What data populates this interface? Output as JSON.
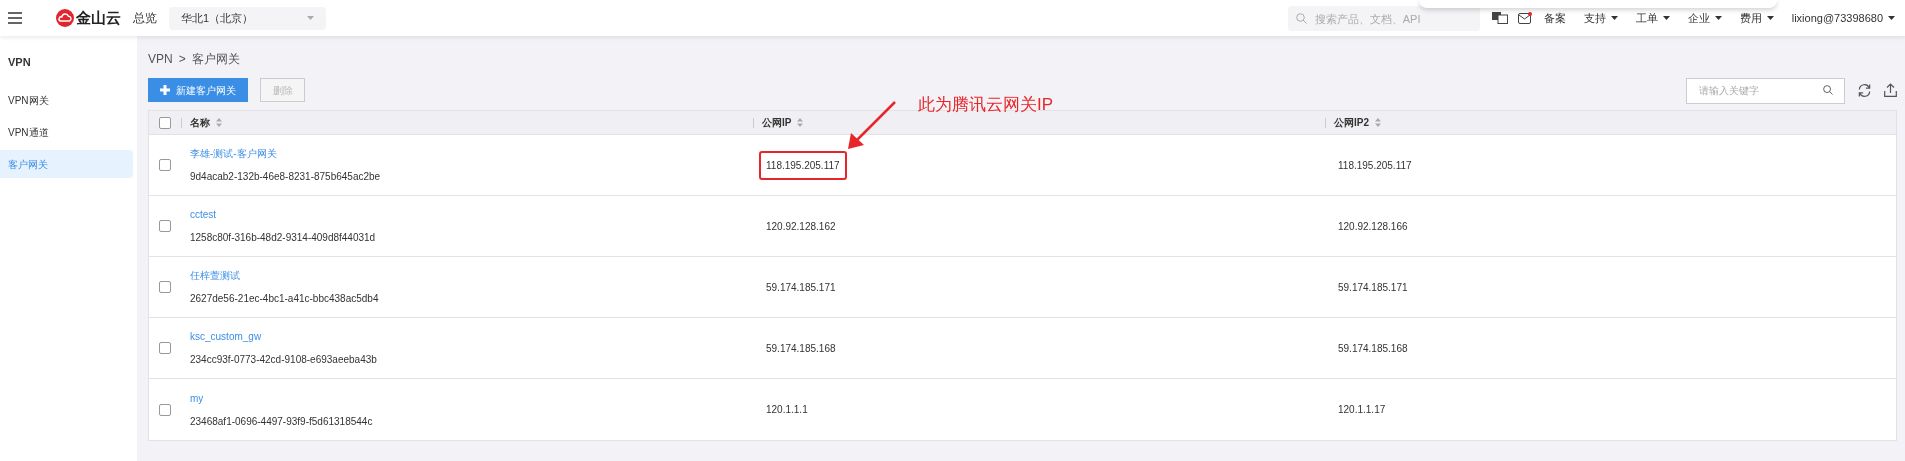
{
  "header": {
    "logo_text": "金山云",
    "overview": "总览",
    "region": "华北1（北京）",
    "search_placeholder": "搜索产品、文档、API",
    "nav": [
      {
        "label": "备案",
        "dropdown": false
      },
      {
        "label": "支持",
        "dropdown": true
      },
      {
        "label": "工单",
        "dropdown": true
      },
      {
        "label": "企业",
        "dropdown": true
      },
      {
        "label": "费用",
        "dropdown": true
      },
      {
        "label": "lixiong@73398680",
        "dropdown": true
      }
    ]
  },
  "sidebar": {
    "title": "VPN",
    "items": [
      {
        "label": "VPN网关",
        "selected": false
      },
      {
        "label": "VPN通道",
        "selected": false
      },
      {
        "label": "客户网关",
        "selected": true
      }
    ]
  },
  "breadcrumb": [
    "VPN",
    ">",
    "客户网关"
  ],
  "toolbar": {
    "create_button": "新建客户网关",
    "delete_button": {
      "label": "删除",
      "disabled": true
    },
    "search_placeholder": "请输入关键字"
  },
  "table": {
    "header_checked": false,
    "columns": [
      "名称",
      "公网IP",
      "公网IP2"
    ],
    "rows": [
      {
        "checked": false,
        "name": "李雄-测试-客户网关",
        "id": "9d4acab2-132b-46e8-8231-875b645ac2be",
        "ip": "118.195.205.117",
        "ip_highlighted": true,
        "ip2": "118.195.205.117"
      },
      {
        "checked": false,
        "name": "cctest",
        "id": "1258c80f-316b-48d2-9314-409d8f44031d",
        "ip": "120.92.128.162",
        "ip_highlighted": false,
        "ip2": "120.92.128.166"
      },
      {
        "checked": false,
        "name": "任梓萱测试",
        "id": "2627de56-21ec-4bc1-a41c-bbc438ac5db4",
        "ip": "59.174.185.171",
        "ip_highlighted": false,
        "ip2": "59.174.185.171"
      },
      {
        "checked": false,
        "name": "ksc_custom_gw",
        "id": "234cc93f-0773-42cd-9108-e693aeeba43b",
        "ip": "59.174.185.168",
        "ip_highlighted": false,
        "ip2": "59.174.185.168"
      },
      {
        "checked": false,
        "name": "my",
        "id": "23468af1-0696-4497-93f9-f5d61318544c",
        "ip": "120.1.1.1",
        "ip_highlighted": false,
        "ip2": "120.1.1.17"
      }
    ]
  },
  "annotation": "此为腾讯云网关IP"
}
